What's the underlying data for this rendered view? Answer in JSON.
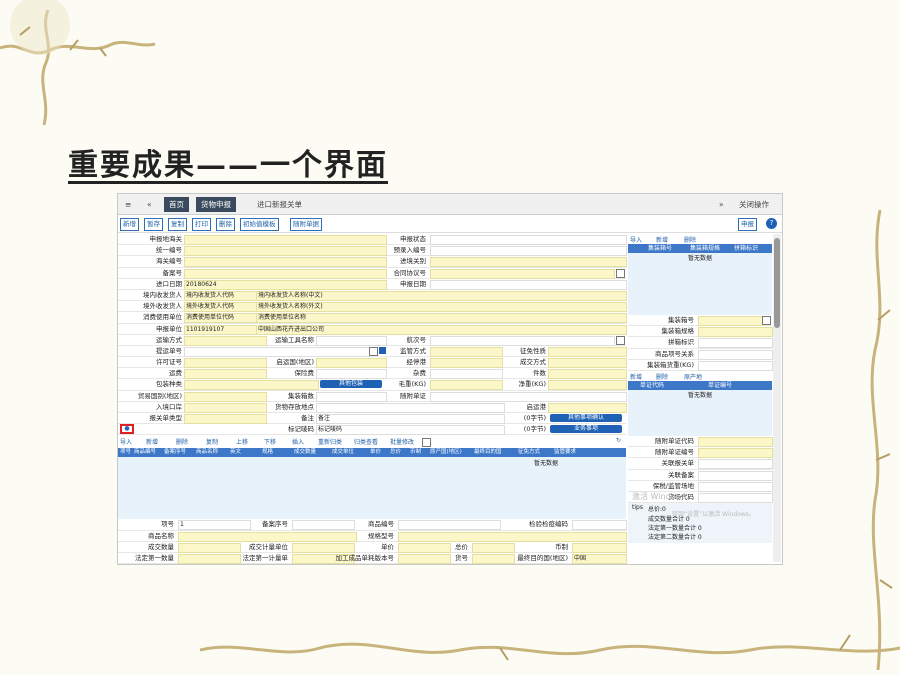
{
  "slide": {
    "title": "重要成果——一个界面"
  },
  "app": {
    "tabs": [
      "首页",
      "货物申报",
      "进口新报关单"
    ],
    "close_ops": "关闭操作"
  },
  "toolbar": {
    "buttons": [
      "新增",
      "暂存",
      "复制",
      "打印",
      "删除",
      "初始值模板",
      "随附单据"
    ],
    "declare": "申报"
  },
  "form": {
    "rows": [
      {
        "l1": "申报地海关",
        "v1": "",
        "l2": "申报状态",
        "v2": ""
      },
      {
        "l1": "统一编号",
        "v1": "",
        "l2": "预录入编号",
        "v2": ""
      },
      {
        "l1": "海关编号",
        "v1": "",
        "l2": "进境关别",
        "v2": ""
      },
      {
        "l1": "备案号",
        "v1": "",
        "l2": "合同协议号",
        "v2": ""
      },
      {
        "l1": "进口日期",
        "v1": "20180624",
        "l2": "申报日期",
        "v2": ""
      },
      {
        "l1": "境内收发货人",
        "v1": "境内收发货人代码",
        "v1b": "境内收发货人名称(中文)"
      },
      {
        "l1": "境外收发货人",
        "v1": "境外收发货人代码",
        "v1b": "境外收发货人名称(外文)"
      },
      {
        "l1": "消费使用单位",
        "v1": "消费使用单位代码",
        "v1b": "消费使用单位名称"
      },
      {
        "l1": "申报单位",
        "v1": "1101919107",
        "v1b": "中国山西花卉进出口公司"
      },
      {
        "l1": "运输方式",
        "l1b": "运输工具名称",
        "l2": "航次号"
      },
      {
        "l1": "提运单号",
        "l2": "监管方式",
        "l3": "征免性质"
      },
      {
        "l1": "许可证号",
        "l1b": "启运国(地区)",
        "l2": "经停港",
        "l3": "成交方式"
      },
      {
        "l1": "运费",
        "l1b": "保险费",
        "l2": "杂费",
        "l3": "件数"
      },
      {
        "l1": "包装种类",
        "btn": "其他包装",
        "l2": "毛重(KG)",
        "l3": "净重(KG)"
      },
      {
        "l1": "贸易国别(地区)",
        "l1b": "集装箱数",
        "l2": "随附单证"
      },
      {
        "l1": "入境口岸",
        "l1b": "货物存放地点",
        "l3": "启运港"
      },
      {
        "l1": "报关单类型",
        "l1b": "备注",
        "v1b": "备注",
        "l3": "(0字节)",
        "btn": "其他事项确认"
      },
      {
        "l1": "",
        "l1b": "标记唛码",
        "v1b": "标记唛码",
        "l3": "(0字节)",
        "btn": "业务事项"
      }
    ]
  },
  "goods": {
    "toolbar": [
      "导入",
      "新增",
      "删除",
      "复制",
      "上移",
      "下移",
      "插入",
      "重新归类",
      "归类查看",
      "批量修改"
    ],
    "columns": [
      "项号",
      "商品编号",
      "备案序号",
      "商品名称",
      "英文",
      "规格",
      "成交数量",
      "成交单位",
      "单价",
      "总价",
      "币制",
      "原产国(地区)",
      "最终目的国",
      "征免方式",
      "监管要求"
    ],
    "empty": "暂无数据",
    "detail": [
      {
        "a": "项号",
        "av": "1",
        "b": "备案序号",
        "c": "商品编号",
        "d": "检验检疫编码"
      },
      {
        "a": "商品名称",
        "c": "规格型号"
      },
      {
        "a": "成交数量",
        "b": "成交计量单位",
        "c": "单价",
        "c2": "总价",
        "d": "币制"
      },
      {
        "a": "法定第一数量",
        "b": "法定第一计量单位",
        "c": "加工成品单耗版本号",
        "c2": "货号",
        "d": "最终目的国(地区)",
        "dv": "中国"
      }
    ]
  },
  "side": {
    "container_toolbar": [
      "导入",
      "新增",
      "删除"
    ],
    "container_cols": [
      "集装箱号",
      "集装箱规格",
      "拼箱标识"
    ],
    "empty": "暂无数据",
    "container_fields": [
      "集装箱号",
      "集装箱规格",
      "拼箱标识",
      "商品项号关系",
      "集装箱货重(KG)"
    ],
    "cert_toolbar": [
      "新增",
      "删除",
      "原产地"
    ],
    "cert_cols": [
      "单证代码",
      "单证编号"
    ],
    "attach_fields": [
      "随附单证代码",
      "随附单证编号",
      "关联报关单",
      "关联备案",
      "保税/监管场地",
      "货场代码"
    ],
    "summary_tips": "tips",
    "summary": [
      "总价:0",
      "成交数量合计 0",
      "法定第一数量合计 0",
      "法定第二数量合计 0"
    ],
    "watermark": "激活 Windows",
    "watermark2": "转到“设置”以激活 Windows。"
  }
}
